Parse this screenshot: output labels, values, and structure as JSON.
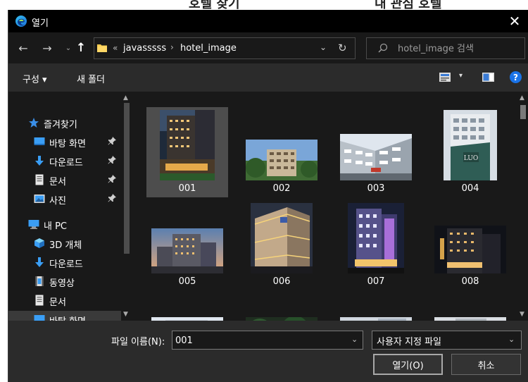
{
  "window": {
    "title": "열기",
    "close_glyph": "✕",
    "app_icon": "edge-browser-icon"
  },
  "background_page": {
    "left_heading": "호텔 찾기",
    "right_heading": "내 관심 호텔"
  },
  "nav": {
    "back_glyph": "←",
    "forward_glyph": "→",
    "recent_glyph": "⌄",
    "up_glyph": "↑",
    "breadcrumb_chevron": "«",
    "breadcrumb_sep": "›",
    "breadcrumbs": [
      "javasssss",
      "hotel_image"
    ],
    "address_dropdown_glyph": "⌄",
    "refresh_glyph": "↻",
    "search_placeholder": "hotel_image 검색"
  },
  "toolbar": {
    "organize_label": "구성 ▾",
    "new_folder_label": "새 폴더",
    "view_dropdown_glyph": "▾",
    "help_label": "?"
  },
  "sidebar": {
    "items": [
      {
        "label": "즐겨찾기",
        "icon": "star-icon",
        "pinned": false,
        "selected": false
      },
      {
        "label": "바탕 화면",
        "icon": "desktop-icon",
        "pinned": true,
        "selected": false
      },
      {
        "label": "다운로드",
        "icon": "download-icon",
        "pinned": true,
        "selected": false
      },
      {
        "label": "문서",
        "icon": "document-icon",
        "pinned": true,
        "selected": false
      },
      {
        "label": "사진",
        "icon": "picture-icon",
        "pinned": true,
        "selected": false
      },
      {
        "label": "내 PC",
        "icon": "pc-icon",
        "pinned": false,
        "selected": false
      },
      {
        "label": "3D 개체",
        "icon": "cube-3d-icon",
        "pinned": false,
        "selected": false
      },
      {
        "label": "다운로드",
        "icon": "download-icon",
        "pinned": false,
        "selected": false
      },
      {
        "label": "동영상",
        "icon": "video-icon",
        "pinned": false,
        "selected": false
      },
      {
        "label": "문서",
        "icon": "document-icon",
        "pinned": false,
        "selected": false
      },
      {
        "label": "바탕 화면",
        "icon": "desktop-icon",
        "pinned": false,
        "selected": true
      }
    ]
  },
  "files": [
    {
      "name": "001",
      "selected": true
    },
    {
      "name": "002",
      "selected": false
    },
    {
      "name": "003",
      "selected": false
    },
    {
      "name": "004",
      "selected": false
    },
    {
      "name": "005",
      "selected": false
    },
    {
      "name": "006",
      "selected": false
    },
    {
      "name": "007",
      "selected": false
    },
    {
      "name": "008",
      "selected": false
    },
    {
      "name": "",
      "selected": false
    },
    {
      "name": "",
      "selected": false
    },
    {
      "name": "",
      "selected": false
    },
    {
      "name": "",
      "selected": false
    }
  ],
  "bottom": {
    "filename_label": "파일 이름(N):",
    "filename_value": "001",
    "filter_value": "사용자 지정 파일",
    "dropdown_glyph": "⌄",
    "open_label": "열기(O)",
    "cancel_label": "취소"
  },
  "colors": {
    "accent": "#1a73e8",
    "folder": "#f2c94c",
    "dialog_bg": "#191919",
    "toolbar_bg": "#2b2b2b",
    "selection": "#4d4d4d"
  }
}
